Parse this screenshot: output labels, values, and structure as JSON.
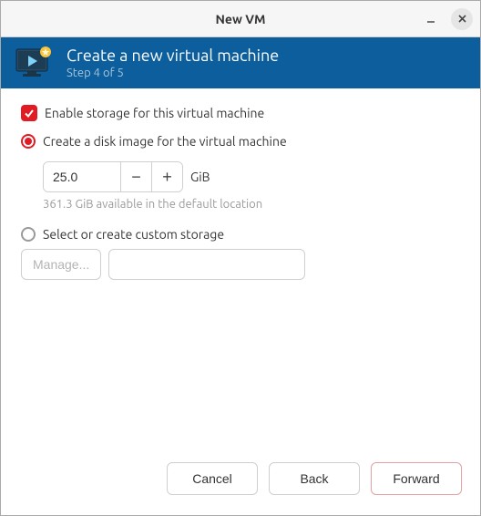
{
  "window": {
    "title": "New VM"
  },
  "header": {
    "title": "Create a new virtual machine",
    "step": "Step 4 of 5"
  },
  "storage": {
    "enable_label": "Enable storage for this virtual machine",
    "create_disk_label": "Create a disk image for the virtual machine",
    "size_value": "25.0",
    "size_unit": "GiB",
    "available_hint": "361.3 GiB available in the default location",
    "custom_label": "Select or create custom storage",
    "manage_label": "Manage...",
    "custom_path": ""
  },
  "footer": {
    "cancel": "Cancel",
    "back": "Back",
    "forward": "Forward"
  }
}
